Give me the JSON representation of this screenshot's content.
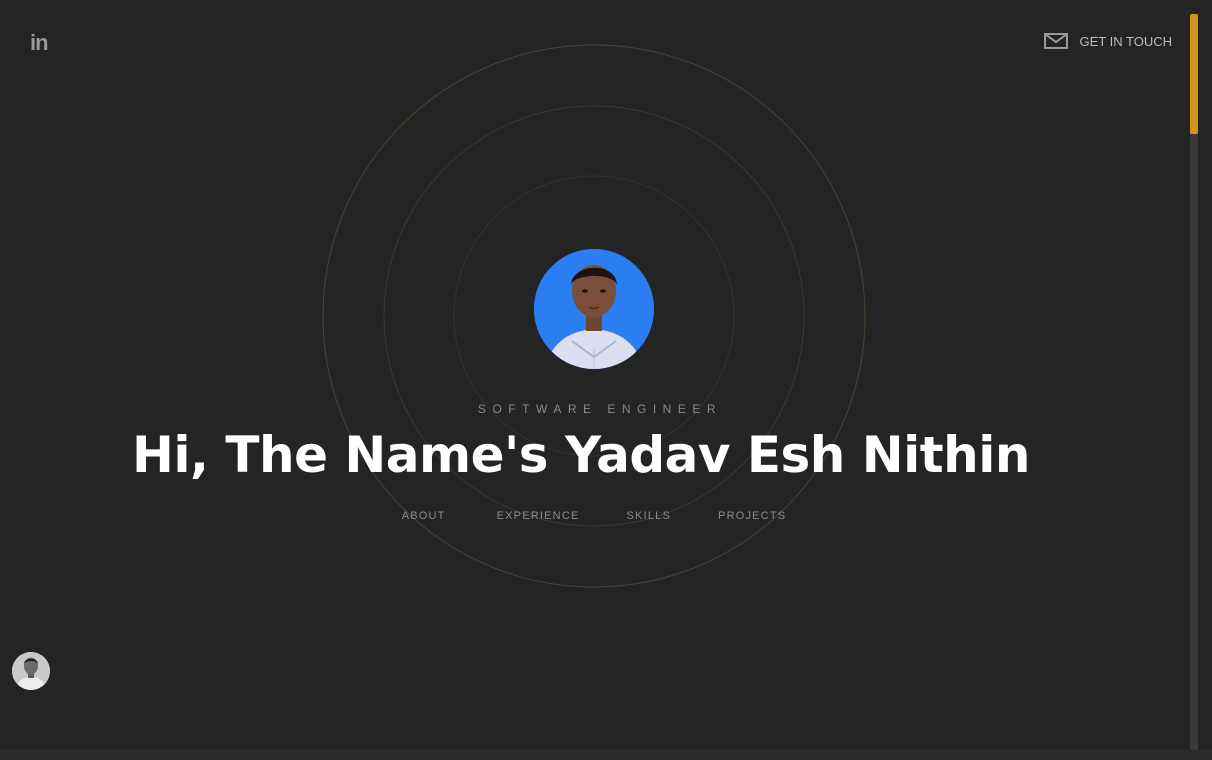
{
  "header": {
    "linkedin_label": "in",
    "contact_label": "GET IN TOUCH",
    "contact_icon": "mail-icon"
  },
  "hero": {
    "role": "SOFTWARE ENGINEER",
    "headline": "Hi, The Name's Yadav Esh Nithin",
    "avatar_icon": "profile-photo"
  },
  "nav": {
    "items": [
      {
        "label": "ABOUT"
      },
      {
        "label": "EXPERIENCE"
      },
      {
        "label": "SKILLS"
      },
      {
        "label": "PROJECTS"
      }
    ]
  },
  "colors": {
    "background": "#242424",
    "accent": "#d4961a",
    "ring": "#4a4430",
    "text": "#ffffff",
    "muted": "#8c8c8c"
  }
}
